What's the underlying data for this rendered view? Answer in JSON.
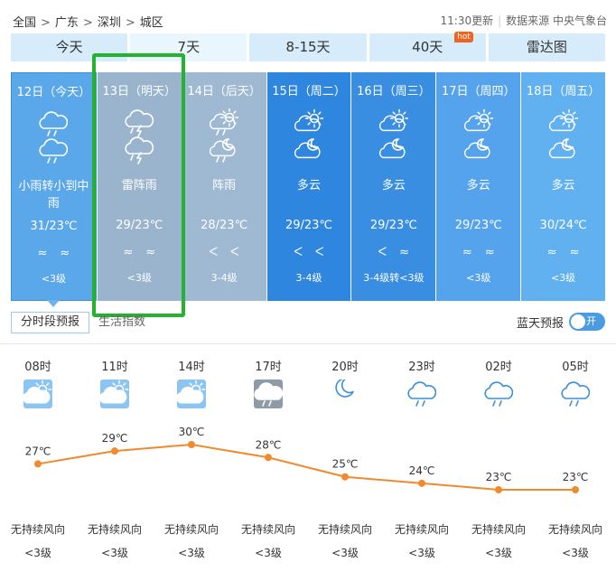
{
  "breadcrumb": {
    "items": [
      "全国",
      "广东",
      "深圳",
      "城区"
    ],
    "separator": ">"
  },
  "header": {
    "update_time": "11:30更新",
    "source": "数据来源 中央气象台"
  },
  "tabs": [
    {
      "label": "今天",
      "active": false
    },
    {
      "label": "7天",
      "active": true
    },
    {
      "label": "8-15天",
      "active": false
    },
    {
      "label": "40天",
      "active": false,
      "badge": "hot"
    },
    {
      "label": "雷达图",
      "active": false
    }
  ],
  "days": [
    {
      "date": "12日（今天）",
      "icon_day": "cloud-rain-icon",
      "icon_night": "cloud-rain-icon",
      "desc": "小雨转小到中雨",
      "temp": "31/23℃",
      "wind_day": "≈",
      "wind_night": "≈",
      "level": "<3级",
      "bg": "#5aa7ea"
    },
    {
      "date": "13日（明天）",
      "icon_day": "thunder-rain-icon",
      "icon_night": "thunder-rain-icon",
      "desc": "雷阵雨",
      "temp": "29/23℃",
      "wind_day": "≈",
      "wind_night": "≈",
      "level": "<3级",
      "bg": "#9ab4cd"
    },
    {
      "date": "14日（后天）",
      "icon_day": "sun-shower-icon",
      "icon_night": "moon-shower-icon",
      "desc": "阵雨",
      "temp": "28/23℃",
      "wind_day": "ᐸ",
      "wind_night": "ᐸ",
      "level": "3-4级",
      "bg": "#9fb9d2"
    },
    {
      "date": "15日（周二）",
      "icon_day": "partly-cloudy-icon",
      "icon_night": "moon-cloud-icon",
      "desc": "多云",
      "temp": "29/23℃",
      "wind_day": "ᐸ",
      "wind_night": "ᐸ",
      "level": "3-4级",
      "bg": "#2f86de"
    },
    {
      "date": "16日（周三）",
      "icon_day": "partly-cloudy-icon",
      "icon_night": "moon-cloud-icon",
      "desc": "多云",
      "temp": "29/23℃",
      "wind_day": "ᐸ",
      "wind_night": "≈",
      "level": "3-4级转<3级",
      "bg": "#3a8ee2"
    },
    {
      "date": "17日（周四）",
      "icon_day": "partly-cloudy-icon",
      "icon_night": "moon-cloud-icon",
      "desc": "多云",
      "temp": "29/23℃",
      "wind_day": "≈",
      "wind_night": "≈",
      "level": "<3级",
      "bg": "#55a3ec"
    },
    {
      "date": "18日（周五）",
      "icon_day": "partly-cloudy-icon",
      "icon_night": "moon-cloud-icon",
      "desc": "多云",
      "temp": "30/24℃",
      "wind_day": "≈",
      "wind_night": "≈",
      "level": "<3级",
      "bg": "#61b0f0"
    }
  ],
  "subtabs": [
    {
      "label": "分时段预报",
      "active": true
    },
    {
      "label": "生活指数",
      "active": false
    }
  ],
  "bluesky": {
    "label": "蓝天预报",
    "toggle": "开"
  },
  "hourly": [
    {
      "time": "08时",
      "icon": "sun-cloud-icon",
      "temp": 27,
      "temp_label": "27℃",
      "wind": "无持续风向",
      "level": "<3级"
    },
    {
      "time": "11时",
      "icon": "sun-cloud-icon",
      "temp": 29,
      "temp_label": "29℃",
      "wind": "无持续风向",
      "level": "<3级"
    },
    {
      "time": "14时",
      "icon": "sun-cloud-icon",
      "temp": 30,
      "temp_label": "30℃",
      "wind": "无持续风向",
      "level": "<3级"
    },
    {
      "time": "17时",
      "icon": "rain-cloud-icon",
      "temp": 28,
      "temp_label": "28℃",
      "wind": "无持续风向",
      "level": "<3级"
    },
    {
      "time": "20时",
      "icon": "moon-icon",
      "temp": 25,
      "temp_label": "25℃",
      "wind": "无持续风向",
      "level": "<3级"
    },
    {
      "time": "23时",
      "icon": "rain-outline-icon",
      "temp": 24,
      "temp_label": "24℃",
      "wind": "无持续风向",
      "level": "<3级"
    },
    {
      "time": "02时",
      "icon": "rain-outline-icon",
      "temp": 23,
      "temp_label": "23℃",
      "wind": "无持续风向",
      "level": "<3级"
    },
    {
      "time": "05时",
      "icon": "rain-outline-icon",
      "temp": 23,
      "temp_label": "23℃",
      "wind": "无持续风向",
      "level": "<3级"
    }
  ],
  "colors": {
    "tab_bg": "#d7ecfb",
    "curve": "#f08a2c",
    "highlight": "#24b32f",
    "icon_blue": "#3b8fd9"
  }
}
